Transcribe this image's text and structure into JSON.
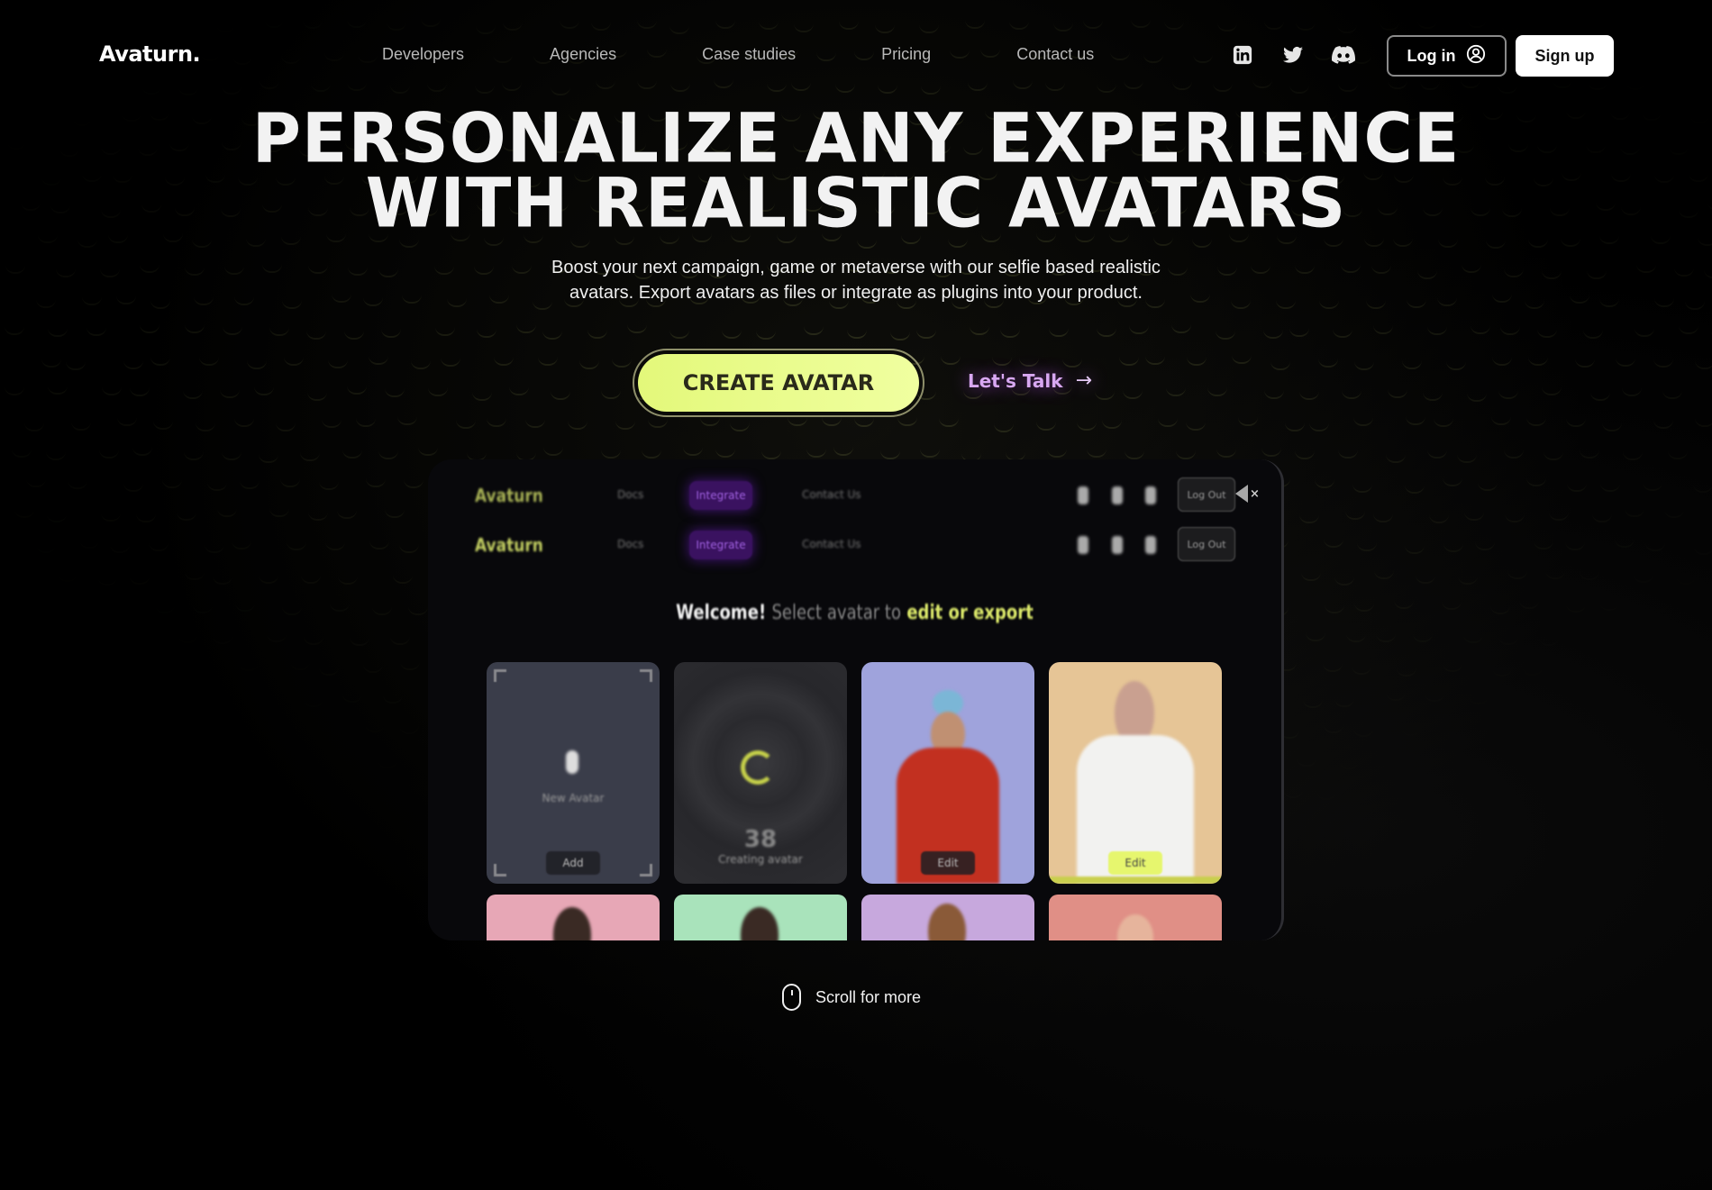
{
  "brand": {
    "logo": "Avaturn."
  },
  "nav": {
    "links": [
      "Developers",
      "Agencies",
      "Case studies",
      "Pricing",
      "Contact us"
    ],
    "socials": [
      "linkedin-icon",
      "twitter-icon",
      "discord-icon"
    ],
    "login_label": "Log in",
    "signup_label": "Sign up"
  },
  "hero": {
    "title_line1": "PERSONALIZE ANY EXPERIENCE",
    "title_line2": "WITH REALISTIC AVATARS",
    "subtitle_line1": "Boost your next campaign, game or metaverse with our selfie based realistic",
    "subtitle_line2": "avatars. Export avatars as files or integrate as plugins into your product.",
    "cta_primary": "CREATE AVATAR",
    "cta_secondary": "Let's Talk",
    "cta_secondary_arrow": "→"
  },
  "preview": {
    "logo": "Avaturn",
    "nav_items": [
      "Docs",
      "Integrate",
      "Contact Us"
    ],
    "button": "Log Out",
    "welcome": {
      "part1": "Welcome!",
      "part2": "Select avatar to",
      "part3": "edit or export"
    },
    "cards": [
      {
        "label": "New Avatar",
        "button": "Add",
        "bg": "#3a3d4a"
      },
      {
        "label": "Creating avatar",
        "progress_text": "38",
        "bg": "#2a2a2e"
      },
      {
        "button": "Edit",
        "bg": "#9fa3dc"
      },
      {
        "button": "Edit",
        "bg": "#e6c596"
      }
    ],
    "row2_colors": [
      "#e7a7b6",
      "#a9e3bb",
      "#c7a8dd",
      "#e08f86"
    ]
  },
  "scroll_hint": "Scroll for more",
  "colors": {
    "accent_lime": "#e6f87a",
    "accent_purple": "#d8a8f2",
    "background": "#000000"
  }
}
